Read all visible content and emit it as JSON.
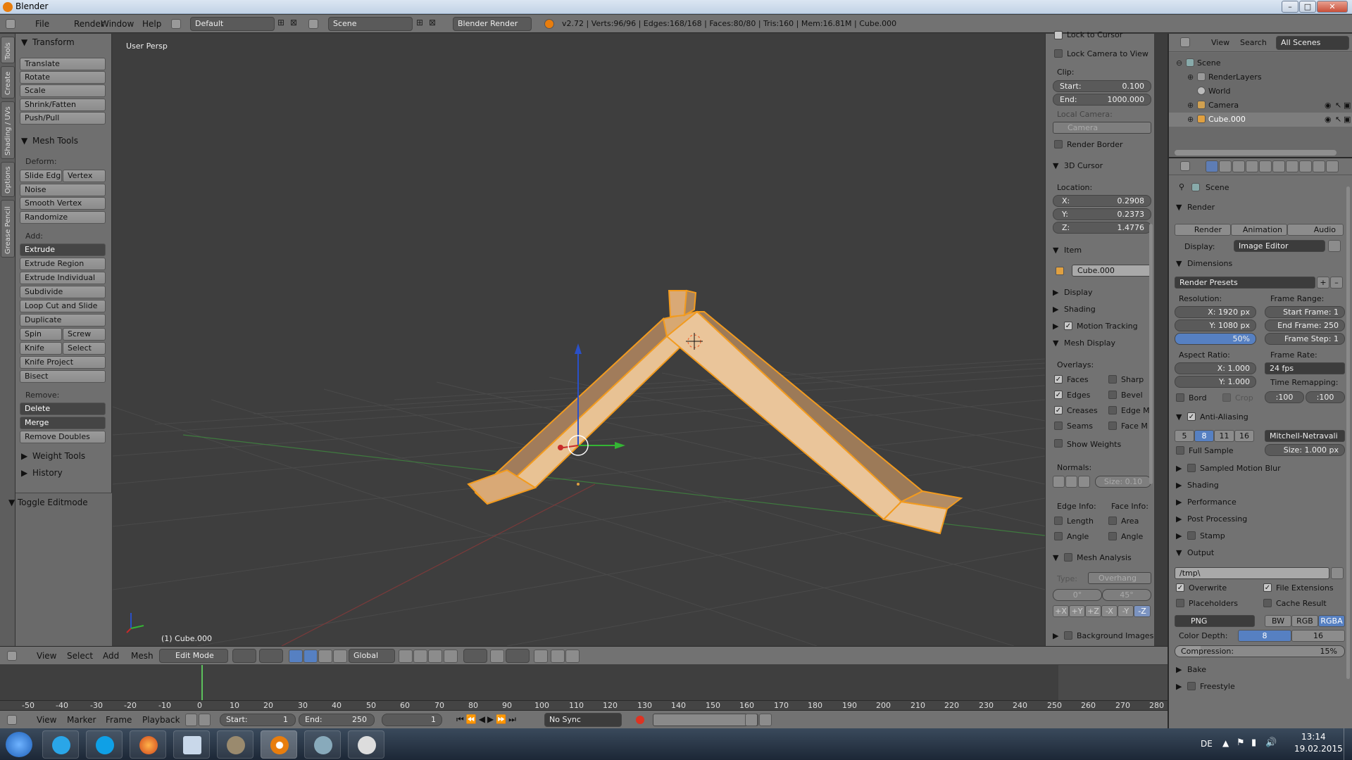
{
  "window": {
    "title": "Blender",
    "min": "–",
    "max": "□",
    "close": "✕"
  },
  "info": {
    "menus": [
      "File",
      "Render",
      "Window",
      "Help"
    ],
    "layout": "Default",
    "scene": "Scene",
    "engine": "Blender Render",
    "stats": "v2.72 | Verts:96/96 | Edges:168/168 | Faces:80/80 | Tris:160 | Mem:16.81M | Cube.000"
  },
  "tabs": [
    "Tools",
    "Create",
    "Shading / UVs",
    "Options",
    "Grease Pencil"
  ],
  "toolshelf": {
    "transform_header": "Transform",
    "transform": [
      "Translate",
      "Rotate",
      "Scale",
      "Shrink/Fatten",
      "Push/Pull"
    ],
    "mesh_tools_header": "Mesh Tools",
    "deform_label": "Deform:",
    "slide_edge": "Slide Edg",
    "vertex": "Vertex",
    "deform": [
      "Noise",
      "Smooth Vertex",
      "Randomize"
    ],
    "add_label": "Add:",
    "extrude": "Extrude",
    "add": [
      "Extrude Region",
      "Extrude Individual",
      "Subdivide",
      "Loop Cut and Slide",
      "Duplicate"
    ],
    "spin": "Spin",
    "screw": "Screw",
    "knife": "Knife",
    "select": "Select",
    "add2": [
      "Knife Project",
      "Bisect"
    ],
    "remove_label": "Remove:",
    "delete": "Delete",
    "merge": "Merge",
    "remove_doubles": "Remove Doubles",
    "weight_tools": "Weight Tools",
    "history": "History",
    "toggle_editmode": "Toggle Editmode"
  },
  "viewport": {
    "view_label": "User Persp",
    "object_label": "(1) Cube.000"
  },
  "npanel": {
    "lock_cursor": "Lock to Cursor",
    "lock_camera": "Lock Camera to View",
    "clip_label": "Clip:",
    "clip_start_label": "Start:",
    "clip_start": "0.100",
    "clip_end_label": "End:",
    "clip_end": "1000.000",
    "local_camera_label": "Local Camera:",
    "local_camera": "Camera",
    "render_border": "Render Border",
    "cursor_header": "3D Cursor",
    "location_label": "Location:",
    "x_label": "X:",
    "x": "0.2908",
    "y_label": "Y:",
    "y": "0.2373",
    "z_label": "Z:",
    "z": "1.4776",
    "item_header": "Item",
    "item_name": "Cube.000",
    "display_header": "Display",
    "shading_header": "Shading",
    "motion_tracking": "Motion Tracking",
    "mesh_display_header": "Mesh Display",
    "overlays_label": "Overlays:",
    "faces": "Faces",
    "sharp": "Sharp",
    "edges": "Edges",
    "bevel": "Bevel",
    "creases": "Creases",
    "edge_m": "Edge M",
    "seams": "Seams",
    "face_m": "Face M",
    "show_weights": "Show Weights",
    "normals_label": "Normals:",
    "normals_size": "Size:  0.10",
    "edge_info_label": "Edge Info:",
    "face_info_label": "Face Info:",
    "length": "Length",
    "area": "Area",
    "angle": "Angle",
    "angle2": "Angle",
    "mesh_analysis": "Mesh Analysis",
    "type_label": "Type:",
    "type": "Overhang",
    "min": "0°",
    "max": "45°",
    "axes": [
      "+X",
      "+Y",
      "+Z",
      "-X",
      "-Y",
      "-Z"
    ],
    "background_images": "Background Images"
  },
  "outliner": {
    "view": "View",
    "search": "Search",
    "all_scenes": "All Scenes",
    "items": [
      "Scene",
      "RenderLayers",
      "World",
      "Camera",
      "Cube.000"
    ]
  },
  "properties": {
    "scene": "Scene",
    "render_header": "Render",
    "render_btn": "Render",
    "animation_btn": "Animation",
    "audio_btn": "Audio",
    "display_label": "Display:",
    "display_value": "Image Editor",
    "dimensions_header": "Dimensions",
    "render_presets": "Render Presets",
    "resolution_label": "Resolution:",
    "frame_range_label": "Frame Range:",
    "res_x": "X:      1920 px",
    "res_y": "Y:      1080 px",
    "res_pct": "50%",
    "start_frame": "Start Frame:   1",
    "end_frame": "End Frame:  250",
    "frame_step": "Frame Step:   1",
    "aspect_label": "Aspect Ratio:",
    "frame_rate_label": "Frame Rate:",
    "asp_x": "X:     1.000",
    "asp_y": "Y:     1.000",
    "fps": "24 fps",
    "time_remap_label": "Time Remapping:",
    "bord": "Bord",
    "crop": "Crop",
    "remap_old": ":100",
    "remap_new": ":100",
    "aa_header": "Anti-Aliasing",
    "aa_samples": [
      "5",
      "8",
      "11",
      "16"
    ],
    "aa_filter": "Mitchell-Netravali",
    "full_sample": "Full Sample",
    "aa_size": "Size:   1.000 px",
    "sampled_motion_blur": "Sampled Motion Blur",
    "shading": "Shading",
    "performance": "Performance",
    "post_processing": "Post Processing",
    "stamp": "Stamp",
    "output_header": "Output",
    "output_path": "/tmp\\",
    "overwrite": "Overwrite",
    "file_extensions": "File Extensions",
    "placeholders": "Placeholders",
    "cache_result": "Cache Result",
    "format": "PNG",
    "bw": "BW",
    "rgb": "RGB",
    "rgba": "RGBA",
    "color_depth_label": "Color Depth:",
    "depth_8": "8",
    "depth_16": "16",
    "compression": "Compression:",
    "compression_value": "15%",
    "bake": "Bake",
    "freestyle": "Freestyle"
  },
  "viewheader": {
    "menus": [
      "View",
      "Select",
      "Add",
      "Mesh"
    ],
    "mode": "Edit Mode",
    "orientation": "Global"
  },
  "timeline": {
    "ticks": [
      "-50",
      "-40",
      "-30",
      "-20",
      "-10",
      "0",
      "10",
      "20",
      "30",
      "40",
      "50",
      "60",
      "70",
      "80",
      "90",
      "100",
      "110",
      "120",
      "130",
      "140",
      "150",
      "160",
      "170",
      "180",
      "190",
      "200",
      "210",
      "220",
      "230",
      "240",
      "250",
      "260",
      "270",
      "280"
    ],
    "menus": [
      "View",
      "Marker",
      "Frame",
      "Playback"
    ],
    "start": "Start:",
    "start_val": "1",
    "end": "End:",
    "end_val": "250",
    "current": "1",
    "sync": "No Sync"
  },
  "taskbar": {
    "lang": "DE",
    "time": "13:14",
    "date": "19.02.2015"
  }
}
